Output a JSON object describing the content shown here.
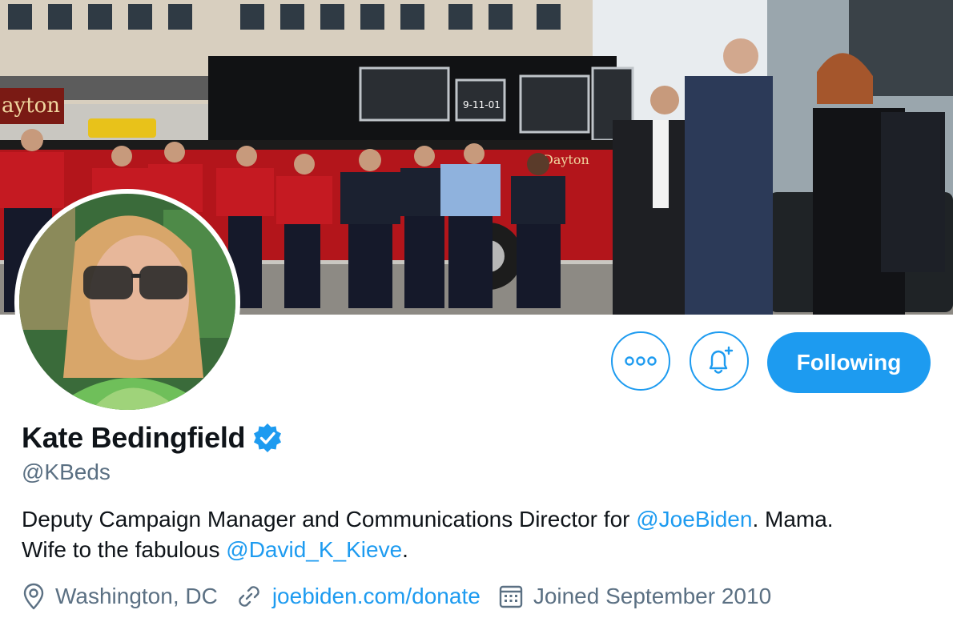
{
  "profile": {
    "name": "Kate Bedingfield",
    "handle": "@KBeds",
    "bio": {
      "part1": "Deputy Campaign Manager and Communications Director for ",
      "mention1": "@JoeBiden",
      "part2": ". Mama.",
      "part3": "Wife to the fabulous ",
      "mention2": "@David_K_Kieve",
      "part4": "."
    },
    "location": "Washington, DC",
    "website": "joebiden.com/donate",
    "joined": "Joined September 2010"
  },
  "actions": {
    "more_icon": "more-icon",
    "notify_icon": "bell-plus-icon",
    "follow_label": "Following"
  },
  "banner": {
    "truck_text": "ayton",
    "truck_sign": "9-11-01",
    "door_text": "Dayton"
  },
  "colors": {
    "accent": "#1d9bf0",
    "secondary_text": "#5b7083"
  }
}
